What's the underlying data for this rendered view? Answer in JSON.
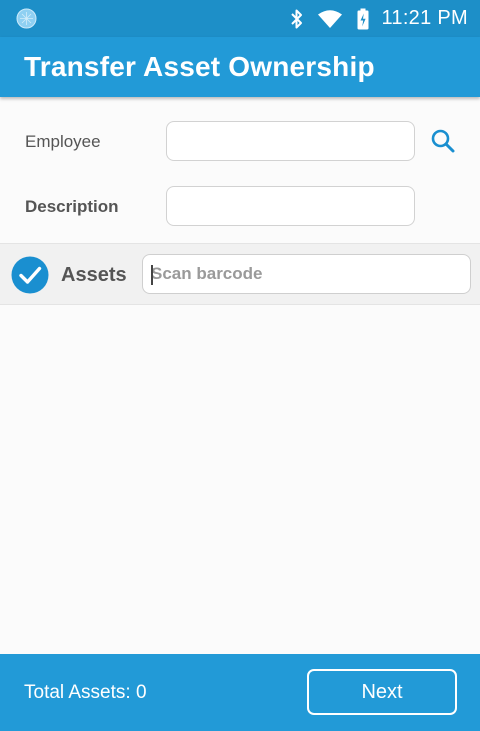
{
  "status_bar": {
    "time": "11:21 PM",
    "icons": [
      "app-status-icon",
      "bluetooth-icon",
      "wifi-icon",
      "battery-icon"
    ]
  },
  "app_bar": {
    "title": "Transfer Asset Ownership"
  },
  "form": {
    "employee_label": "Employee",
    "employee_value": "",
    "description_label": "Description",
    "description_value": "",
    "search_icon": "search-icon"
  },
  "assets": {
    "label": "Assets",
    "scan_placeholder": "Scan barcode",
    "checked": true
  },
  "footer": {
    "total_label": "Total Assets: 0",
    "next_label": "Next"
  },
  "colors": {
    "primary": "#229ad7",
    "status_bar": "#1d8fc8",
    "icon_blue": "#1a8fd0"
  }
}
